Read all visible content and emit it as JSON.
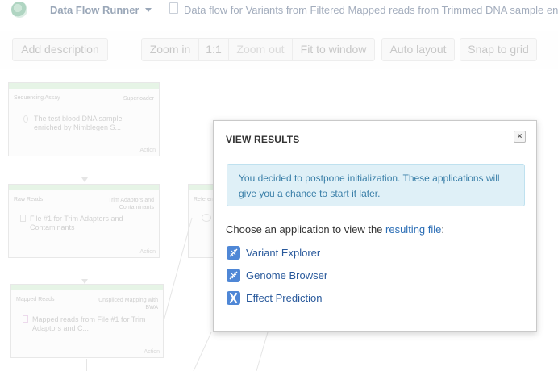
{
  "header": {
    "app_title": "Data Flow Runner",
    "breadcrumb": "Data flow for Variants from Filtered Mapped reads from Trimmed DNA sample en"
  },
  "toolbar": {
    "add_description": "Add description",
    "zoom_in": "Zoom in",
    "one_to_one": "1:1",
    "zoom_out": "Zoom out",
    "fit_to_window": "Fit to window",
    "auto_layout": "Auto layout",
    "snap_to_grid": "Snap to grid"
  },
  "nodes": [
    {
      "left": "Sequencing Assay",
      "right": "Superloader",
      "body": [
        "The test blood DNA sample",
        "enriched by Nimblegen S..."
      ],
      "action": "Action"
    },
    {
      "left": "Raw Reads",
      "right": [
        "Trim Adaptors and",
        "Contaminants"
      ],
      "body": [
        "File #1 for Trim Adaptors and",
        "Contaminants"
      ],
      "action": "Action"
    },
    {
      "left": "Mapped Reads",
      "right": [
        "Unspliced Mapping with",
        "BWA"
      ],
      "body": [
        "Mapped reads from File #1 for Trim",
        "Adaptors and C..."
      ],
      "action": "Action"
    },
    {
      "left": "Referen"
    }
  ],
  "modal": {
    "title": "VIEW RESULTS",
    "close_label": "×",
    "alert": "You decided to postpone initialization. These applications will give you a chance to start it later.",
    "choose_prefix": "Choose an application to view the ",
    "choose_link": "resulting file",
    "choose_suffix": ":",
    "apps": [
      {
        "label": "Variant Explorer",
        "icon": "dna-icon"
      },
      {
        "label": "Genome Browser",
        "icon": "dna-icon"
      },
      {
        "label": "Effect Prediction",
        "icon": "chromosome-icon"
      }
    ]
  },
  "colors": {
    "accent": "#2a6db5",
    "alert_bg": "#dff0f7",
    "alert_text": "#3a7fa8",
    "node_bar": "#d9eed9"
  }
}
